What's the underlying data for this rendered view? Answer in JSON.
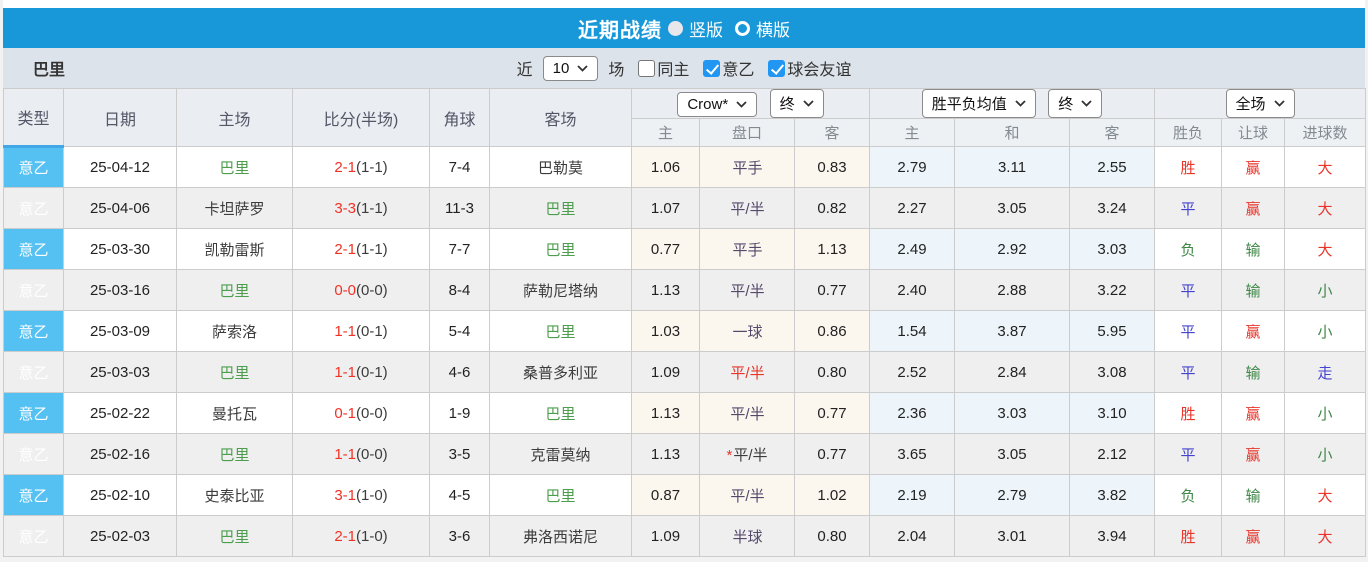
{
  "titlebar": {
    "title": "近期战绩",
    "layout_options": [
      {
        "label": "竖版",
        "selected": true
      },
      {
        "label": "横版",
        "selected": false
      }
    ]
  },
  "toolbar": {
    "team": "巴里",
    "recent_label": "近",
    "recent_count": "10",
    "matches_label": "场",
    "checkboxes": [
      {
        "label": "同主",
        "checked": false
      },
      {
        "label": "意乙",
        "checked": true
      },
      {
        "label": "球会友谊",
        "checked": true
      }
    ]
  },
  "colors": {
    "accent_blue": "#1898d8",
    "league_badge": "#55c1f2",
    "checkbox_checked": "#2196f3",
    "win_red": "#e8352a",
    "draw_blue": "#4343cf",
    "loss_green": "#3f8747",
    "team_green": "#4c9e4c",
    "handicap_purple": "#55486b"
  },
  "table": {
    "headers": {
      "type": "类型",
      "date": "日期",
      "home": "主场",
      "score": "比分(半场)",
      "corner": "角球",
      "away": "客场"
    },
    "groups": {
      "handicap": {
        "bookmaker": "Crow*",
        "time": "终",
        "sub": [
          "主",
          "盘口",
          "客"
        ]
      },
      "odds": {
        "type": "胜平负均值",
        "time": "终",
        "sub": [
          "主",
          "和",
          "客"
        ]
      },
      "result": {
        "scope": "全场",
        "sub": [
          "胜负",
          "让球",
          "进球数"
        ]
      }
    },
    "rows": [
      {
        "league": "意乙",
        "date": "25-04-12",
        "home": "巴里",
        "home_c": "green",
        "score": "2-1",
        "half": "(1-1)",
        "corner": "7-4",
        "away": "巴勒莫",
        "away_c": "dark",
        "ahH": "1.06",
        "lineStar": "",
        "line": "平手",
        "line_c": "purple",
        "ahA": "0.83",
        "oH": "2.79",
        "oD": "3.11",
        "oA": "2.55",
        "wdl": "胜",
        "wdl_c": "red",
        "handi": "赢",
        "handi_c": "red",
        "goal": "大",
        "goal_c": "red"
      },
      {
        "league": "意乙",
        "date": "25-04-06",
        "home": "卡坦萨罗",
        "home_c": "dark",
        "score": "3-3",
        "half": "(1-1)",
        "corner": "11-3",
        "away": "巴里",
        "away_c": "green",
        "ahH": "1.07",
        "lineStar": "",
        "line": "平/半",
        "line_c": "purple",
        "ahA": "0.82",
        "oH": "2.27",
        "oD": "3.05",
        "oA": "3.24",
        "wdl": "平",
        "wdl_c": "blue",
        "handi": "赢",
        "handi_c": "red",
        "goal": "大",
        "goal_c": "red"
      },
      {
        "league": "意乙",
        "date": "25-03-30",
        "home": "凯勒雷斯",
        "home_c": "dark",
        "score": "2-1",
        "half": "(1-1)",
        "corner": "7-7",
        "away": "巴里",
        "away_c": "green",
        "ahH": "0.77",
        "lineStar": "",
        "line": "平手",
        "line_c": "purple",
        "ahA": "1.13",
        "oH": "2.49",
        "oD": "2.92",
        "oA": "3.03",
        "wdl": "负",
        "wdl_c": "rgreen",
        "handi": "输",
        "handi_c": "rgreen",
        "goal": "大",
        "goal_c": "red"
      },
      {
        "league": "意乙",
        "date": "25-03-16",
        "home": "巴里",
        "home_c": "green",
        "score": "0-0",
        "half": "(0-0)",
        "corner": "8-4",
        "away": "萨勒尼塔纳",
        "away_c": "dark",
        "ahH": "1.13",
        "lineStar": "",
        "line": "平/半",
        "line_c": "purple",
        "ahA": "0.77",
        "oH": "2.40",
        "oD": "2.88",
        "oA": "3.22",
        "wdl": "平",
        "wdl_c": "blue",
        "handi": "输",
        "handi_c": "rgreen",
        "goal": "小",
        "goal_c": "rgreen"
      },
      {
        "league": "意乙",
        "date": "25-03-09",
        "home": "萨索洛",
        "home_c": "dark",
        "score": "1-1",
        "half": "(0-1)",
        "corner": "5-4",
        "away": "巴里",
        "away_c": "green",
        "ahH": "1.03",
        "lineStar": "",
        "line": "一球",
        "line_c": "purple",
        "ahA": "0.86",
        "oH": "1.54",
        "oD": "3.87",
        "oA": "5.95",
        "wdl": "平",
        "wdl_c": "blue",
        "handi": "赢",
        "handi_c": "red",
        "goal": "小",
        "goal_c": "rgreen"
      },
      {
        "league": "意乙",
        "date": "25-03-03",
        "home": "巴里",
        "home_c": "green",
        "score": "1-1",
        "half": "(0-1)",
        "corner": "4-6",
        "away": "桑普多利亚",
        "away_c": "dark",
        "ahH": "1.09",
        "lineStar": "",
        "line": "平/半",
        "line_c": "red",
        "ahA": "0.80",
        "oH": "2.52",
        "oD": "2.84",
        "oA": "3.08",
        "wdl": "平",
        "wdl_c": "blue",
        "handi": "输",
        "handi_c": "rgreen",
        "goal": "走",
        "goal_c": "blue"
      },
      {
        "league": "意乙",
        "date": "25-02-22",
        "home": "曼托瓦",
        "home_c": "dark",
        "score": "0-1",
        "half": "(0-0)",
        "corner": "1-9",
        "away": "巴里",
        "away_c": "green",
        "ahH": "1.13",
        "lineStar": "",
        "line": "平/半",
        "line_c": "purple",
        "ahA": "0.77",
        "oH": "2.36",
        "oD": "3.03",
        "oA": "3.10",
        "wdl": "胜",
        "wdl_c": "red",
        "handi": "赢",
        "handi_c": "red",
        "goal": "小",
        "goal_c": "rgreen"
      },
      {
        "league": "意乙",
        "date": "25-02-16",
        "home": "巴里",
        "home_c": "green",
        "score": "1-1",
        "half": "(0-0)",
        "corner": "3-5",
        "away": "克雷莫纳",
        "away_c": "dark",
        "ahH": "1.13",
        "lineStar": "*",
        "line": "平/半",
        "line_c": "dark",
        "ahA": "0.77",
        "oH": "3.65",
        "oD": "3.05",
        "oA": "2.12",
        "wdl": "平",
        "wdl_c": "blue",
        "handi": "赢",
        "handi_c": "red",
        "goal": "小",
        "goal_c": "rgreen"
      },
      {
        "league": "意乙",
        "date": "25-02-10",
        "home": "史泰比亚",
        "home_c": "dark",
        "score": "3-1",
        "half": "(1-0)",
        "corner": "4-5",
        "away": "巴里",
        "away_c": "green",
        "ahH": "0.87",
        "lineStar": "",
        "line": "平/半",
        "line_c": "purple",
        "ahA": "1.02",
        "oH": "2.19",
        "oD": "2.79",
        "oA": "3.82",
        "wdl": "负",
        "wdl_c": "rgreen",
        "handi": "输",
        "handi_c": "rgreen",
        "goal": "大",
        "goal_c": "red"
      },
      {
        "league": "意乙",
        "date": "25-02-03",
        "home": "巴里",
        "home_c": "green",
        "score": "2-1",
        "half": "(1-0)",
        "corner": "3-6",
        "away": "弗洛西诺尼",
        "away_c": "dark",
        "ahH": "1.09",
        "lineStar": "",
        "line": "半球",
        "line_c": "purple",
        "ahA": "0.80",
        "oH": "2.04",
        "oD": "3.01",
        "oA": "3.94",
        "wdl": "胜",
        "wdl_c": "red",
        "handi": "赢",
        "handi_c": "red",
        "goal": "大",
        "goal_c": "red"
      }
    ]
  }
}
